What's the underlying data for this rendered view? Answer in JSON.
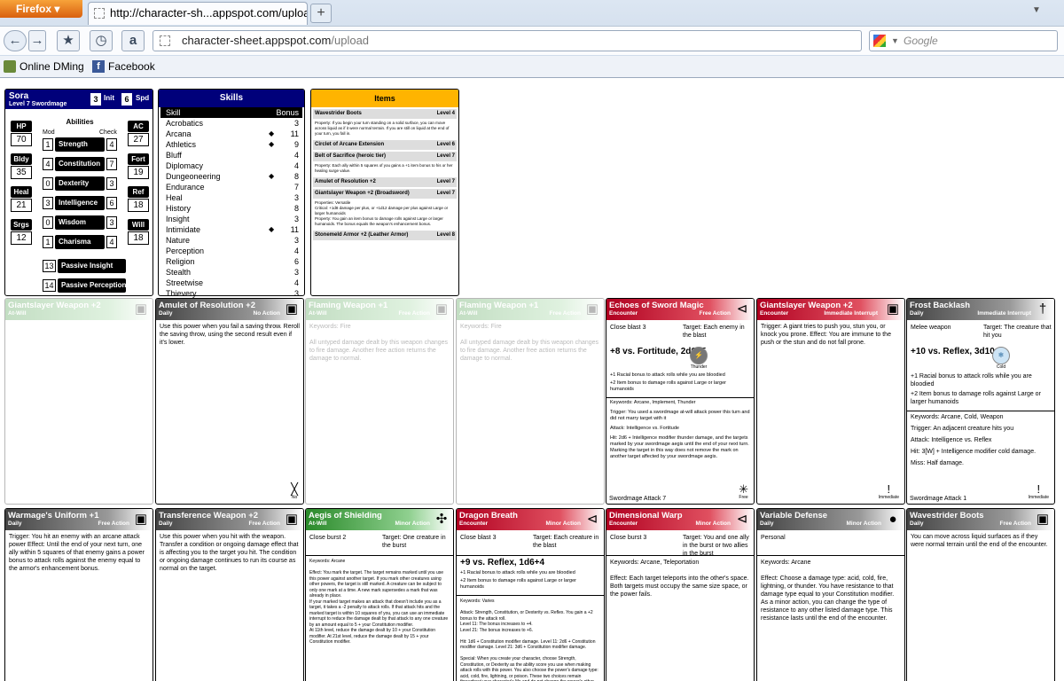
{
  "browser": {
    "app_button": "Firefox",
    "tab_title": "http://character-sh...appspot.com/upload",
    "url_domain": "character-sheet.appspot.com",
    "url_path": "/upload",
    "search_placeholder": "Google",
    "bookmarks": [
      "Online DMing",
      "Facebook"
    ]
  },
  "character": {
    "name": "Sora",
    "level_class": "Level 7 Swordmage",
    "init": "3",
    "init_label": "Init",
    "speed": "6",
    "speed_label": "Spd",
    "abilities_title": "Abilities",
    "mod_label": "Mod",
    "check_label": "Check",
    "left_stats": [
      {
        "label": "HP",
        "value": "70"
      },
      {
        "label": "Bldy",
        "value": "35"
      },
      {
        "label": "Heal",
        "value": "21"
      },
      {
        "label": "Srgs",
        "value": "12"
      }
    ],
    "right_stats": [
      {
        "label": "AC",
        "value": "27"
      },
      {
        "label": "Fort",
        "value": "19"
      },
      {
        "label": "Ref",
        "value": "18"
      },
      {
        "label": "Will",
        "value": "18"
      }
    ],
    "abilities": [
      {
        "mod": "1",
        "name": "Strength",
        "check": "4"
      },
      {
        "mod": "4",
        "name": "Constitution",
        "check": "7"
      },
      {
        "mod": "0",
        "name": "Dexterity",
        "check": "3"
      },
      {
        "mod": "3",
        "name": "Intelligence",
        "check": "6"
      },
      {
        "mod": "0",
        "name": "Wisdom",
        "check": "3"
      },
      {
        "mod": "1",
        "name": "Charisma",
        "check": "4"
      }
    ],
    "passives": [
      {
        "value": "13",
        "name": "Passive Insight"
      },
      {
        "value": "14",
        "name": "Passive Perception"
      }
    ]
  },
  "skills": {
    "title": "Skills",
    "col_skill": "Skill",
    "col_bonus": "Bonus",
    "rows": [
      {
        "name": "Acrobatics",
        "trained": "",
        "bonus": "3"
      },
      {
        "name": "Arcana",
        "trained": "◆",
        "bonus": "11"
      },
      {
        "name": "Athletics",
        "trained": "◆",
        "bonus": "9"
      },
      {
        "name": "Bluff",
        "trained": "",
        "bonus": "4"
      },
      {
        "name": "Diplomacy",
        "trained": "",
        "bonus": "4"
      },
      {
        "name": "Dungeoneering",
        "trained": "◆",
        "bonus": "8"
      },
      {
        "name": "Endurance",
        "trained": "",
        "bonus": "7"
      },
      {
        "name": "Heal",
        "trained": "",
        "bonus": "3"
      },
      {
        "name": "History",
        "trained": "",
        "bonus": "8"
      },
      {
        "name": "Insight",
        "trained": "",
        "bonus": "3"
      },
      {
        "name": "Intimidate",
        "trained": "◆",
        "bonus": "11"
      },
      {
        "name": "Nature",
        "trained": "",
        "bonus": "3"
      },
      {
        "name": "Perception",
        "trained": "",
        "bonus": "4"
      },
      {
        "name": "Religion",
        "trained": "",
        "bonus": "6"
      },
      {
        "name": "Stealth",
        "trained": "",
        "bonus": "3"
      },
      {
        "name": "Streetwise",
        "trained": "",
        "bonus": "4"
      },
      {
        "name": "Thievery",
        "trained": "",
        "bonus": "3"
      }
    ]
  },
  "items": {
    "title": "Items",
    "list": [
      {
        "name": "Wavestrider Boots",
        "level": "Level 4",
        "text": "Property: If you begin your turn standing on a solid surface, you can move across liquid as if it were normal terrain. If you are still on liquid at the end of your turn, you fall in."
      },
      {
        "name": "Circlet of Arcane Extension",
        "level": "Level 6",
        "text": ""
      },
      {
        "name": "Belt of Sacrifice (heroic tier)",
        "level": "Level 7",
        "text": "Property: Each ally within 5 squares of you gains a +1 item bonus to his or her healing surge value."
      },
      {
        "name": "Amulet of Resolution +2",
        "level": "Level 7",
        "text": ""
      },
      {
        "name": "Giantslayer Weapon +2 (Broadsword)",
        "level": "Level 7",
        "text": "Properties: Versatile\nCritical: +1d8 damage per plus, or +1d12 damage per plus against Large or larger humanoids\nProperty: You gain an item bonus to damage rolls against Large or larger humanoids. The bonus equals the weapon's enhancement bonus."
      },
      {
        "name": "Stonemeld Armor +2 (Leather Armor)",
        "level": "Level 8",
        "text": ""
      }
    ]
  },
  "cards_row1": [
    {
      "title": "Giantslayer Weapon +2",
      "freq": "At-Will",
      "action": "",
      "body": "",
      "faded": true,
      "header": "h-atwill"
    },
    {
      "title": "Amulet of Resolution +2",
      "freq": "Daily",
      "action": "No Action",
      "body": "Use this power when you fail a saving throw. Reroll the saving throw, using the second result even if it's lower.",
      "faded": false,
      "header": "h-daily",
      "foot_icon_label": "No"
    },
    {
      "title": "Flaming Weapon +1",
      "freq": "At-Will",
      "action": "Free Action",
      "body": "Keywords: Fire\n\nAll untyped damage dealt by this weapon changes to fire damage. Another free action returns the damage to normal.",
      "faded": true,
      "header": "h-atwill"
    },
    {
      "title": "Flaming Weapon +1",
      "freq": "At-Will",
      "action": "Free Action",
      "body": "Keywords: Fire\n\nAll untyped damage dealt by this weapon changes to fire damage. Another free action returns the damage to normal.",
      "faded": true,
      "header": "h-atwill"
    }
  ],
  "echoes": {
    "title": "Echoes of Sword Magic",
    "freq": "Encounter",
    "action": "Free Action",
    "range": "Close blast 3",
    "target": "Target: Each enemy in the blast",
    "attack": "+8 vs. Fortitude, 2d6+5",
    "icon_label": "Thunder",
    "bullets": [
      "+1 Racial bonus to attack rolls while you are bloodied",
      "+2 Item bonus to damage rolls against Large or larger humanoids"
    ],
    "keywords": "Keywords: Arcane, Implement, Thunder",
    "trigger": "Trigger: You used a swordmage at-will attack power this turn and did not marry target with it",
    "attack_line": "Attack: Intelligence vs. Fortitude",
    "hit": "Hit: 2d6 + Intelligence modifier thunder damage, and the targets marked by your swordmage aegis until the end of your next turn. Marking the target in this way does not remove the mark on another target affected by your swordmage aegis.",
    "footer": "Swordmage Attack 7",
    "foot_icon_label": "Free"
  },
  "giantslayer_interrupt": {
    "title": "Giantslayer Weapon +2",
    "freq": "Encounter",
    "action": "Immediate Interrupt",
    "body": "Trigger: A giant tries to push you, stun you, or knock you prone. Effect: You are immune to the push or the stun and do not fall prone.",
    "foot_icon_label": "Immediate"
  },
  "frost": {
    "title": "Frost Backlash",
    "freq": "Daily",
    "action": "Immediate Interrupt",
    "range": "Melee weapon",
    "target": "Target: The creature that hit you",
    "attack": "+10 vs. Reflex, 3d10+5",
    "icon_label": "Cold",
    "bullets": [
      "+1 Racial bonus to attack rolls while you are bloodied",
      "+2 Item bonus to damage rolls against Large or larger humanoids"
    ],
    "keywords": "Keywords: Arcane, Cold, Weapon",
    "trigger": "Trigger: An adjacent creature hits you",
    "attack_line": "Attack: Intelligence vs. Reflex",
    "hit": "Hit: 3[W] + Intelligence modifier cold damage.",
    "miss": "Miss: Half damage.",
    "footer": "Swordmage Attack 1",
    "foot_icon_label": "Immediate"
  },
  "cards_row2": [
    {
      "title": "Warmage's Uniform +1",
      "freq": "Daily",
      "action": "Free Action",
      "header": "h-daily",
      "range": "",
      "target": "",
      "body": "Trigger: You hit an enemy with an arcane attack power Effect: Until the end of your next turn, one ally within 5 squares of that enemy gains a power bonus to attack rolls against the enemy equal to the armor's enhancement bonus."
    },
    {
      "title": "Transference Weapon +2",
      "freq": "Daily",
      "action": "Free Action",
      "header": "h-daily",
      "range": "",
      "target": "",
      "body": "Use this power when you hit with the weapon. Transfer a condition or ongoing damage effect that is affecting you to the target you hit. The condition or ongoing damage continues to run its course as normal on the target."
    },
    {
      "title": "Aegis of Shielding",
      "freq": "At-Will",
      "action": "Minor Action",
      "header": "h-atwill",
      "range": "Close burst 2",
      "target": "Target: One creature in the burst",
      "body": "Keywords: Arcane\n\nEffect: You mark the target. The target remains marked until you use this power against another target. If you mark other creatures using other powers, the target is still marked. A creature can be subject to only one mark at a time. A new mark supersedes a mark that was already in place.\nIf your marked target makes an attack that doesn't include you as a target, it takes a -2 penalty to attack rolls. If that attack hits and the marked target is within 10 squares of you, you can use an immediate interrupt to reduce the damage dealt by that attack to any one creature by an amount equal to 5 + your Constitution modifier.\nAt 11th level, reduce the damage dealt by 10 + your Constitution modifier. At 21st level, reduce the damage dealt by 15 + your Constitution modifier."
    },
    {
      "title": "Dragon Breath",
      "freq": "Encounter",
      "action": "Minor Action",
      "header": "h-enc",
      "range": "Close blast 3",
      "target": "Target: Each creature in the blast",
      "attack": "+9 vs. Reflex, 1d6+4",
      "bullets": [
        "+1 Racial bonus to attack rolls while you are bloodied",
        "+2 Item bonus to damage rolls against Large or larger humanoids"
      ],
      "body": "Keywords: Varies\n\nAttack: Strength, Constitution, or Dexterity vs. Reflex. You gain a +2 bonus to the attack roll.\nLevel 11: The bonus increases to +4.\nLevel 21: The bonus increases to +6.\n\nHit: 1d6 + Constitution modifier damage. Level 11: 2d6 + Constitution modifier damage. Level 21: 3d6 + Constitution modifier damage.\n\nSpecial: When you create your character, choose Strength, Constitution, or Dexterity as the ability score you use when making attack rolls with this power. You also choose the power's damage type: acid, cold, fire, lightning, or poison. These two choices remain throughout your character's life and do not change the power's other effects."
    },
    {
      "title": "Dimensional Warp",
      "freq": "Encounter",
      "action": "Minor Action",
      "header": "h-enc",
      "range": "Close burst 3",
      "target": "Target: You and one ally in the burst or two allies in the burst",
      "body": "Keywords: Arcane, Teleportation\n\nEffect: Each target teleports into the other's space. Both targets must occupy the same size space, or the power fails."
    },
    {
      "title": "Variable Defense",
      "freq": "Daily",
      "action": "Minor Action",
      "header": "h-daily",
      "range": "Personal",
      "target": "",
      "body": "Keywords: Arcane\n\nEffect: Choose a damage type: acid, cold, fire, lightning, or thunder. You have resistance to that damage type equal to your Constitution modifier. As a minor action, you can change the type of resistance to any other listed damage type. This resistance lasts until the end of the encounter."
    },
    {
      "title": "Wavestrider Boots",
      "freq": "Daily",
      "action": "Free Action",
      "header": "h-daily",
      "range": "",
      "target": "",
      "body": "You can move across liquid surfaces as if they were normal terrain until the end of the encounter."
    }
  ]
}
